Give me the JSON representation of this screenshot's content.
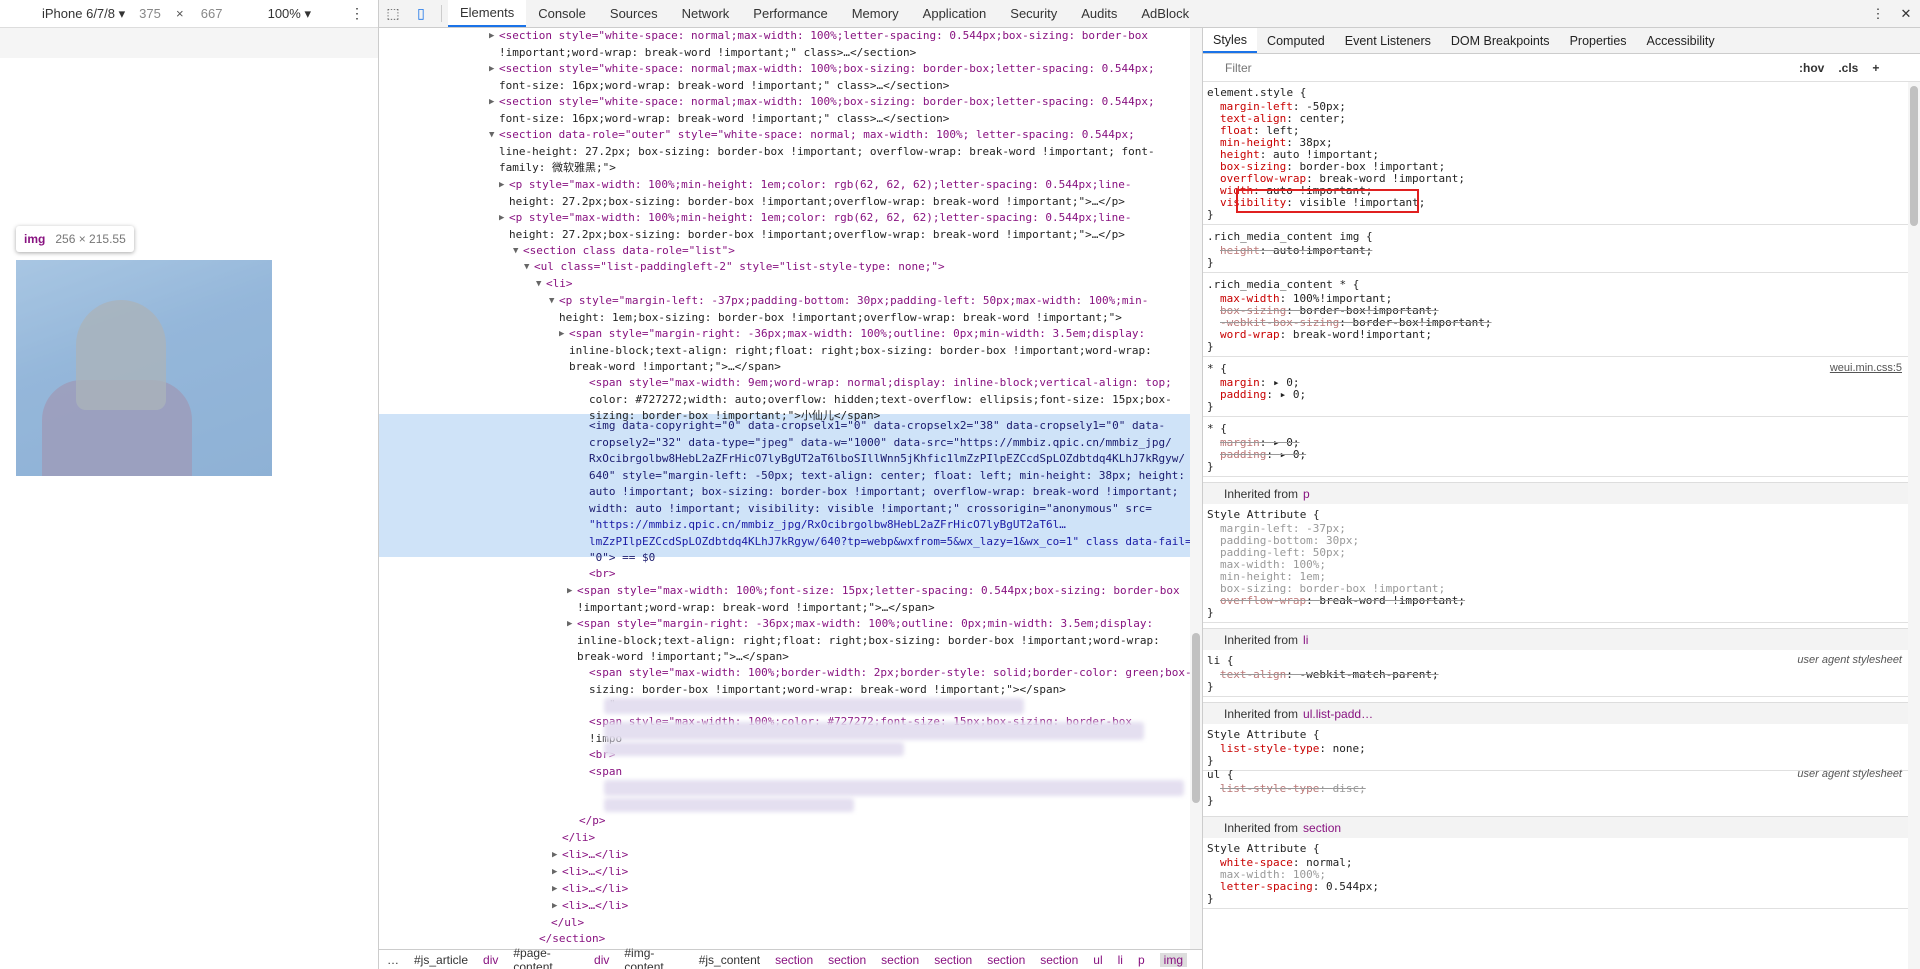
{
  "device_toolbar": {
    "device": "iPhone 6/7/8 ▾",
    "width": "375",
    "height": "667",
    "zoom": "100% ▾"
  },
  "tooltip": {
    "tag": "img",
    "size": "256 × 215.55"
  },
  "tabs": [
    "Elements",
    "Console",
    "Sources",
    "Network",
    "Performance",
    "Memory",
    "Application",
    "Security",
    "Audits",
    "AdBlock"
  ],
  "elements_lines": [
    "<section style=\"white-space: normal;max-width: 100%;letter-spacing: 0.544px;box-sizing: border-box",
    "!important;word-wrap: break-word !important;\" class>…</section>",
    "<section style=\"white-space: normal;max-width: 100%;box-sizing: border-box;letter-spacing: 0.544px;",
    "font-size: 16px;word-wrap: break-word !important;\" class>…</section>",
    "<section style=\"white-space: normal;max-width: 100%;box-sizing: border-box;letter-spacing: 0.544px;",
    "font-size: 16px;word-wrap: break-word !important;\" class>…</section>",
    "<section data-role=\"outer\" style=\"white-space: normal; max-width: 100%; letter-spacing: 0.544px;",
    "line-height: 27.2px; box-sizing: border-box !important; overflow-wrap: break-word !important; font-",
    "family: 微软雅黑;\">",
    "<p style=\"max-width: 100%;min-height: 1em;color: rgb(62, 62, 62);letter-spacing: 0.544px;line-",
    "height: 27.2px;box-sizing: border-box !important;overflow-wrap: break-word !important;\">…</p>",
    "<p style=\"max-width: 100%;min-height: 1em;color: rgb(62, 62, 62);letter-spacing: 0.544px;line-",
    "height: 27.2px;box-sizing: border-box !important;overflow-wrap: break-word !important;\">…</p>",
    "<section class data-role=\"list\">",
    "<ul class=\"list-paddingleft-2\" style=\"list-style-type: none;\">",
    "<li>",
    "<p style=\"margin-left: -37px;padding-bottom: 30px;padding-left: 50px;max-width: 100%;min-",
    "height: 1em;box-sizing: border-box !important;overflow-wrap: break-word !important;\">",
    "<span style=\"margin-right: -36px;max-width: 100%;outline: 0px;min-width: 3.5em;display:",
    "inline-block;text-align: right;float: right;box-sizing: border-box !important;word-wrap:",
    "break-word !important;\">…</span>",
    "<span style=\"max-width: 9em;word-wrap: normal;display: inline-block;vertical-align: top;",
    "color: #727272;width: auto;overflow: hidden;text-overflow: ellipsis;font-size: 15px;box-",
    "sizing: border-box !important;\">小仙儿</span>"
  ],
  "selected_lines": [
    "<img data-copyright=\"0\" data-cropselx1=\"0\" data-cropselx2=\"38\" data-cropsely1=\"0\" data-",
    "cropsely2=\"32\" data-type=\"jpeg\" data-w=\"1000\" data-src=\"https://mmbiz.qpic.cn/mmbiz_jpg/",
    "RxOcibrgolbw8HebL2aZFrHicO7lyBgUT2aT6lboSIllWnn5jKhfic1lmZzPIlpEZCcdSpLOZdbtdq4KLhJ7kRgyw/",
    "640\" style=\"margin-left: -50px; text-align: center; float: left; min-height: 38px; height:",
    "auto !important; box-sizing: border-box !important; overflow-wrap: break-word !important;",
    "width: auto !important; visibility: visible !important;\" crossorigin=\"anonymous\" src=",
    "\"https://mmbiz.qpic.cn/mmbiz_jpg/RxOcibrgolbw8HebL2aZFrHicO7lyBgUT2aT6l…",
    "lmZzPIlpEZCcdSpLOZdbtdq4KLhJ7kRgyw/640?tp=webp&wxfrom=5&wx_lazy=1&wx_co=1\" class data-fail=",
    "\"0\"> == $0"
  ],
  "after_lines": [
    "<br>",
    "<span style=\"max-width: 100%;font-size: 15px;letter-spacing: 0.544px;box-sizing: border-box",
    "!important;word-wrap: break-word !important;\">…</span>",
    "<span style=\"margin-right: -36px;max-width: 100%;outline: 0px;min-width: 3.5em;display:",
    "inline-block;text-align: right;float: right;box-sizing: border-box !important;word-wrap:",
    "break-word !important;\">…</span>",
    "<span style=\"max-width: 100%;border-width: 2px;border-style: solid;border-color: green;box-",
    "sizing: border-box !important;word-wrap: break-word !important;\"></span>",
    "\"",
    "<span style=\"max-width: 100%;color: #727272;font-size: 15px;box-sizing: border-box",
    "!impo",
    "<br>",
    "<span",
    "</p>",
    "</li>",
    "<li>…</li>",
    "<li>…</li>",
    "<li>…</li>",
    "<li>…</li>",
    "</ul>",
    "</section>"
  ],
  "breadcrumb": [
    "…",
    "#js_article",
    "div",
    "#page-content",
    "div",
    "#img-content",
    "#js_content",
    "section",
    "section",
    "section",
    "section",
    "section",
    "section",
    "ul",
    "li",
    "p",
    "img"
  ],
  "style_tabs": [
    "Styles",
    "Computed",
    "Event Listeners",
    "DOM Breakpoints",
    "Properties",
    "Accessibility"
  ],
  "filter": {
    "placeholder": "Filter",
    "hov": ":hov",
    ".cls": ".cls",
    "add": "+"
  },
  "styles": {
    "element_style": {
      "selector": "element.style {",
      "props": [
        [
          "margin-left",
          "-50px"
        ],
        [
          "text-align",
          "center"
        ],
        [
          "float",
          "left"
        ],
        [
          "min-height",
          "38px"
        ],
        [
          "height",
          "auto !important"
        ],
        [
          "box-sizing",
          "border-box !important"
        ],
        [
          "overflow-wrap",
          "break-word !important"
        ],
        [
          "width",
          "auto !important"
        ],
        [
          "visibility",
          "visible !important"
        ]
      ]
    },
    "rule2": {
      "selector": ".rich_media_content img {",
      "props": [
        [
          "height",
          "auto!important"
        ]
      ]
    },
    "rule3": {
      "selector": ".rich_media_content * {",
      "props": [
        [
          "max-width",
          "100%!important"
        ],
        [
          "box-sizing",
          "border-box!important"
        ],
        [
          "-webkit-box-sizing",
          "border-box!important"
        ],
        [
          "word-wrap",
          "break-word!important"
        ]
      ]
    },
    "rule4": {
      "selector": "* {",
      "source": "weui.min.css:5",
      "props": [
        [
          "margin",
          "▸ 0"
        ],
        [
          "padding",
          "▸ 0"
        ]
      ]
    },
    "rule5": {
      "selector": "* {",
      "props": [
        [
          "margin",
          "▸ 0"
        ],
        [
          "padding",
          "▸ 0"
        ]
      ]
    },
    "inh_p": {
      "label": "Inherited from",
      "from": "p",
      "selector": "Style Attribute {",
      "props": [
        [
          "margin-left",
          "-37px"
        ],
        [
          "padding-bottom",
          "30px"
        ],
        [
          "padding-left",
          "50px"
        ],
        [
          "max-width",
          "100%"
        ],
        [
          "min-height",
          "1em"
        ],
        [
          "box-sizing",
          "border-box !important"
        ],
        [
          "overflow-wrap",
          "break-word !important"
        ]
      ]
    },
    "inh_li": {
      "label": "Inherited from",
      "from": "li",
      "selector": "li {",
      "source": "user agent stylesheet",
      "props": [
        [
          "text-align",
          "-webkit-match-parent"
        ]
      ]
    },
    "inh_ul": {
      "label": "Inherited from",
      "from": "ul.list-padd…",
      "selector": "Style Attribute {",
      "props": [
        [
          "list-style-type",
          "none"
        ]
      ],
      "ua_selector": "ul {",
      "ua_source": "user agent stylesheet",
      "ua_props": [
        [
          "list-style-type",
          "disc"
        ]
      ]
    },
    "inh_section": {
      "label": "Inherited from",
      "from": "section",
      "selector": "Style Attribute {",
      "props": [
        [
          "white-space",
          "normal"
        ],
        [
          "max-width",
          "100%"
        ],
        [
          "letter-spacing",
          "0.544px"
        ]
      ]
    }
  }
}
